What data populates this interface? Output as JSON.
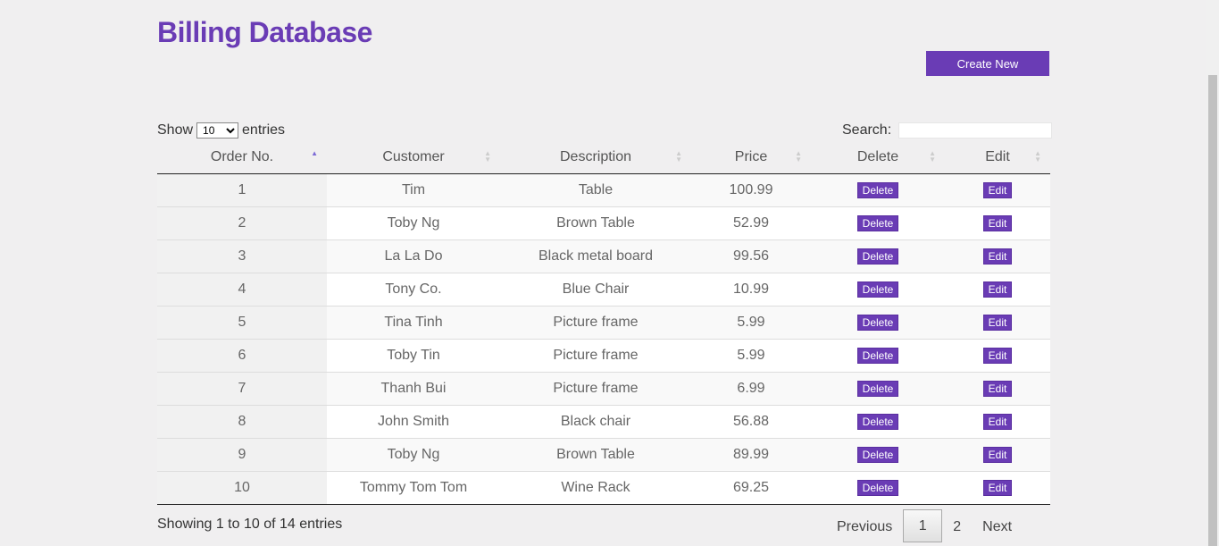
{
  "page": {
    "title": "Billing Database"
  },
  "toolbar": {
    "create_label": "Create New"
  },
  "length": {
    "show_label": "Show",
    "entries_label": "entries",
    "selected": "10"
  },
  "search": {
    "label": "Search:",
    "value": ""
  },
  "table": {
    "columns": [
      "Order No.",
      "Customer",
      "Description",
      "Price",
      "Delete",
      "Edit"
    ],
    "sorted_column": "Order No.",
    "sort_direction": "ascending",
    "delete_label": "Delete",
    "edit_label": "Edit",
    "rows": [
      {
        "order": "1",
        "customer": "Tim",
        "description": "Table",
        "price": "100.99"
      },
      {
        "order": "2",
        "customer": "Toby Ng",
        "description": "Brown Table",
        "price": "52.99"
      },
      {
        "order": "3",
        "customer": "La La Do",
        "description": "Black metal board",
        "price": "99.56"
      },
      {
        "order": "4",
        "customer": "Tony Co.",
        "description": "Blue Chair",
        "price": "10.99"
      },
      {
        "order": "5",
        "customer": "Tina Tinh",
        "description": "Picture frame",
        "price": "5.99"
      },
      {
        "order": "6",
        "customer": "Toby Tin",
        "description": "Picture frame",
        "price": "5.99"
      },
      {
        "order": "7",
        "customer": "Thanh Bui",
        "description": "Picture frame",
        "price": "6.99"
      },
      {
        "order": "8",
        "customer": "John Smith",
        "description": "Black chair",
        "price": "56.88"
      },
      {
        "order": "9",
        "customer": "Toby Ng",
        "description": "Brown Table",
        "price": "89.99"
      },
      {
        "order": "10",
        "customer": "Tommy Tom Tom",
        "description": "Wine Rack",
        "price": "69.25"
      }
    ]
  },
  "info": "Showing 1 to 10 of 14 entries",
  "pagination": {
    "previous": "Previous",
    "pages": [
      "1",
      "2"
    ],
    "current": "1",
    "next": "Next"
  },
  "colors": {
    "accent": "#6a3cb5"
  }
}
